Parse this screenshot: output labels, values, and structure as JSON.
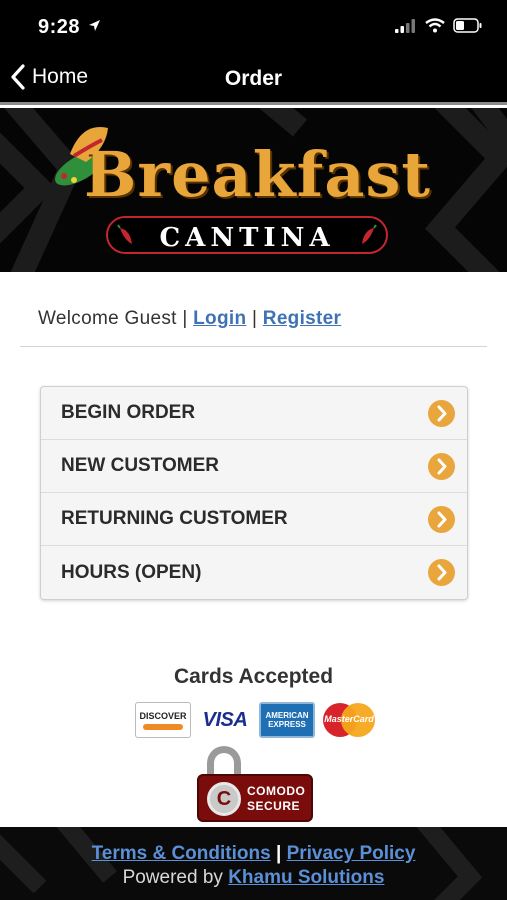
{
  "status_bar": {
    "time": "9:28"
  },
  "nav": {
    "back_label": "Home",
    "title": "Order"
  },
  "brand": {
    "name": "Breakfast",
    "subtitle": "CANTINA",
    "accent_color": "#e7a53a"
  },
  "welcome": {
    "prefix": "Welcome Guest",
    "separator": "|",
    "login": "Login",
    "register": "Register"
  },
  "menu": {
    "items": [
      {
        "label": "BEGIN ORDER"
      },
      {
        "label": "NEW CUSTOMER"
      },
      {
        "label": "RETURNING CUSTOMER"
      },
      {
        "label": "HOURS (OPEN)"
      }
    ]
  },
  "cards": {
    "title": "Cards Accepted",
    "items": [
      {
        "name": "DISCOVER"
      },
      {
        "name": "VISA"
      },
      {
        "name": "AMERICAN EXPRESS"
      },
      {
        "name": "MasterCard"
      }
    ]
  },
  "security_badge": {
    "line1": "COMODO",
    "line2": "SECURE",
    "letter": "C"
  },
  "footer": {
    "terms": "Terms & Conditions",
    "separator": "|",
    "privacy": "Privacy Policy",
    "powered_prefix": "Powered by",
    "powered_link": "Khamu Solutions"
  }
}
